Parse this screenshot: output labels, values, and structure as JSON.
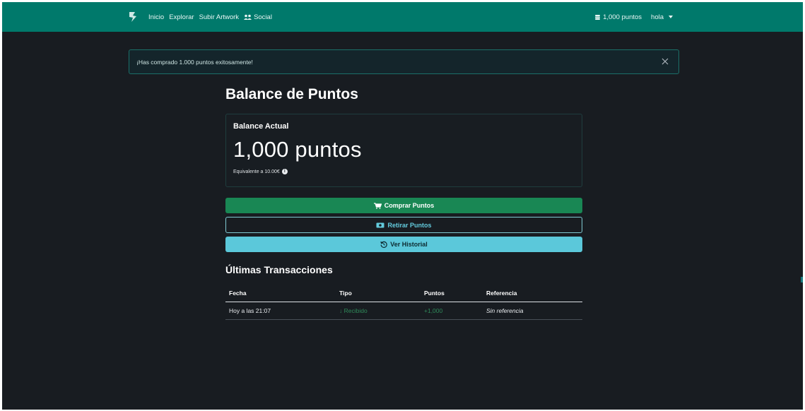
{
  "navbar": {
    "brand_icon": "palette-leaf-icon",
    "links": [
      "Inicio",
      "Explorar",
      "Subir Artwork",
      "Social"
    ],
    "social_icon": "users-icon",
    "points_icon": "coins-icon",
    "points_label": "1,000 puntos",
    "user_label": "hola"
  },
  "alert": {
    "message": "¡Has comprado 1.000 puntos exitosamente!"
  },
  "page": {
    "title": "Balance de Puntos"
  },
  "balance_card": {
    "label": "Balance Actual",
    "amount": "1,000 puntos",
    "equivalent": "Equivalente a 10.00€"
  },
  "actions": {
    "buy": "Comprar Puntos",
    "withdraw": "Retirar Puntos",
    "history": "Ver Historial"
  },
  "transactions": {
    "heading": "Últimas Transacciones",
    "columns": [
      "Fecha",
      "Tipo",
      "Puntos",
      "Referencia"
    ],
    "rows": [
      {
        "fecha": "Hoy a las 21:07",
        "tipo": "Recibido",
        "puntos": "+1,000",
        "referencia": "Sin referencia"
      }
    ]
  },
  "colors": {
    "navbar": "#00796b",
    "background": "#181c21",
    "buy_button": "#198754",
    "history_button": "#5bc8da",
    "withdraw_outline": "#63cbdd"
  }
}
